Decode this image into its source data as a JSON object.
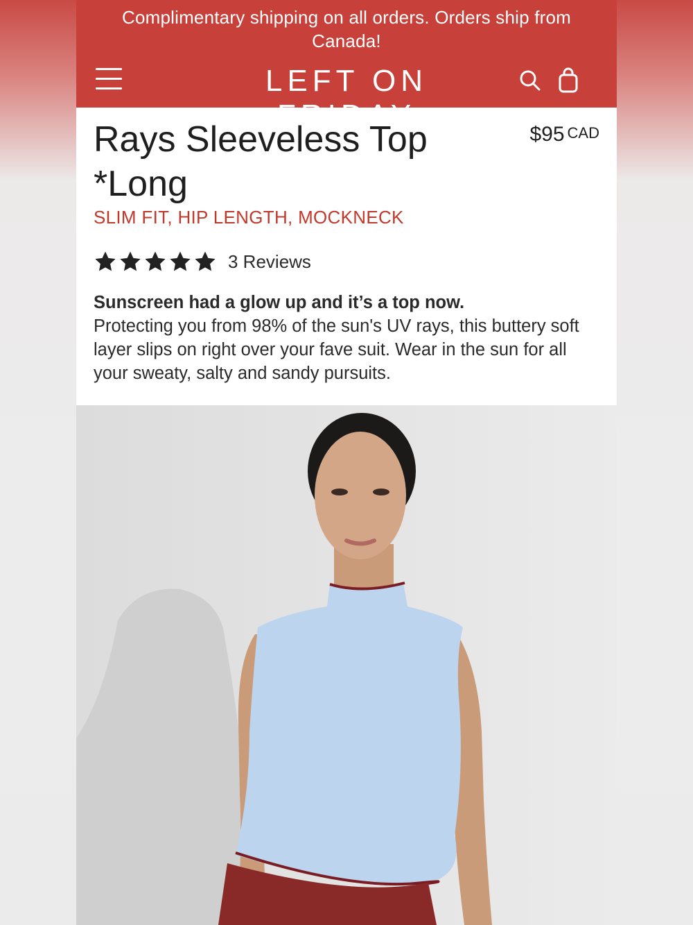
{
  "announcement": "Complimentary shipping on all orders. Orders ship from Canada!",
  "brand": "LEFT ON FRIDAY",
  "icons": {
    "menu": "hamburger-menu-icon",
    "search": "search-icon",
    "cart": "shopping-bag-icon",
    "star": "star-icon"
  },
  "colors": {
    "brand_red": "#c8403a",
    "subtitle_red": "#c0392b",
    "text": "#1e1e1e",
    "top_color": "#bcd4ee",
    "trim_color": "#7a1c24"
  },
  "product": {
    "title": "Rays Sleeveless Top *Long",
    "price": "$95",
    "currency": "CAD",
    "subtitle": "SLIM FIT, HIP LENGTH, MOCKNECK",
    "rating": 5,
    "rating_max": 5,
    "reviews_label": "3 Reviews",
    "description_lead": "Sunscreen had a glow up and it’s a top now.",
    "description_body": "Protecting you from 98% of the sun's UV rays, this buttery soft layer slips on right over your fave suit. Wear in the sun for all your sweaty, salty and sandy pursuits."
  }
}
